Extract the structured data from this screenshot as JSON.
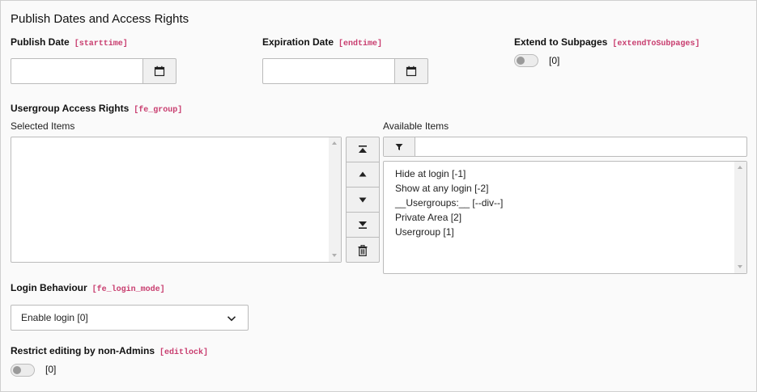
{
  "section": {
    "title": "Publish Dates and Access Rights"
  },
  "publish_date": {
    "label": "Publish Date",
    "key": "[starttime]",
    "value": ""
  },
  "expiration_date": {
    "label": "Expiration Date",
    "key": "[endtime]",
    "value": ""
  },
  "extend_subpages": {
    "label": "Extend to Subpages",
    "key": "[extendToSubpages]",
    "value": "[0]",
    "checked": false
  },
  "usergroup": {
    "label": "Usergroup Access Rights",
    "key": "[fe_group]",
    "selected_label": "Selected Items",
    "available_label": "Available Items",
    "filter_value": "",
    "selected_items": [],
    "available_items": [
      "Hide at login [-1]",
      "Show at any login [-2]",
      "__Usergroups:__ [--div--]",
      "Private Area [2]",
      "Usergroup [1]"
    ]
  },
  "login_behaviour": {
    "label": "Login Behaviour",
    "key": "[fe_login_mode]",
    "selected": "Enable login [0]"
  },
  "restrict_editing": {
    "label": "Restrict editing by non-Admins",
    "key": "[editlock]",
    "value": "[0]",
    "checked": false
  },
  "icons": {
    "calendar": "calendar-icon",
    "move_top": "move-to-top-icon",
    "move_up": "move-up-icon",
    "move_down": "move-down-icon",
    "move_bottom": "move-to-bottom-icon",
    "delete": "trash-icon",
    "filter": "filter-icon",
    "chevron": "chevron-down-icon"
  },
  "colors": {
    "key_accent": "#c83c6e",
    "border": "#bbbbbb",
    "background": "#fafafa"
  }
}
